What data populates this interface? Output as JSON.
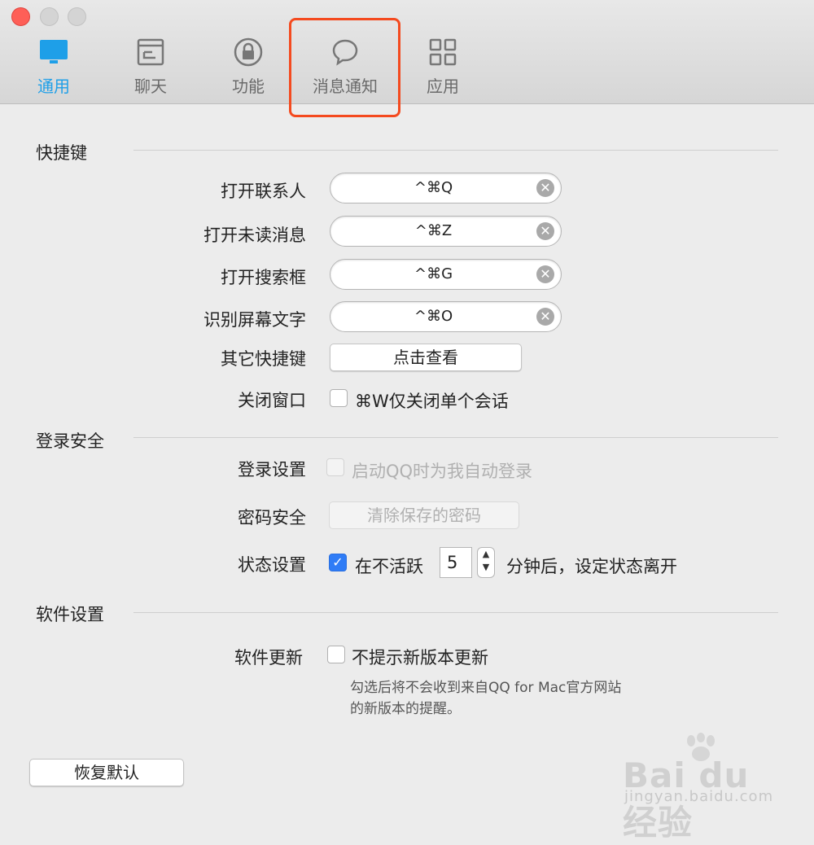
{
  "toolbar": {
    "tabs": [
      {
        "label": "通用",
        "icon": "monitor-icon",
        "active": true
      },
      {
        "label": "聊天",
        "icon": "chat-window-icon",
        "active": false
      },
      {
        "label": "功能",
        "icon": "lock-icon",
        "active": false
      },
      {
        "label": "消息通知",
        "icon": "speech-bubble-icon",
        "active": false
      },
      {
        "label": "应用",
        "icon": "apps-grid-icon",
        "active": false
      }
    ],
    "accent": "#1e9fe8",
    "highlight_color": "#f44a1f"
  },
  "shortcuts": {
    "title": "快捷键",
    "rows": [
      {
        "label": "打开联系人",
        "value": "^⌘Q"
      },
      {
        "label": "打开未读消息",
        "value": "^⌘Z"
      },
      {
        "label": "打开搜索框",
        "value": "^⌘G"
      },
      {
        "label": "识别屏幕文字",
        "value": "^⌘O"
      }
    ],
    "other_label": "其它快捷键",
    "other_button": "点击查看",
    "close_label": "关闭窗口",
    "close_option": "⌘W仅关闭单个会话",
    "close_checked": false
  },
  "security": {
    "title": "登录安全",
    "login_label": "登录设置",
    "login_option": "启动QQ时为我自动登录",
    "login_checked": false,
    "password_label": "密码安全",
    "password_button": "清除保存的密码",
    "status_label": "状态设置",
    "status_prefix": "在不活跃",
    "status_minutes": "5",
    "status_suffix": "分钟后，设定状态离开",
    "status_checked": true
  },
  "software": {
    "title": "软件设置",
    "update_label": "软件更新",
    "update_option": "不提示新版本更新",
    "update_checked": false,
    "note_line1": "勾选后将不会收到来自QQ for Mac官方网站",
    "note_line2": "的新版本的提醒。"
  },
  "footer": {
    "restore_button": "恢复默认"
  },
  "watermark": {
    "brand": "Bai du 经验",
    "url": "jingyan.baidu.com"
  }
}
